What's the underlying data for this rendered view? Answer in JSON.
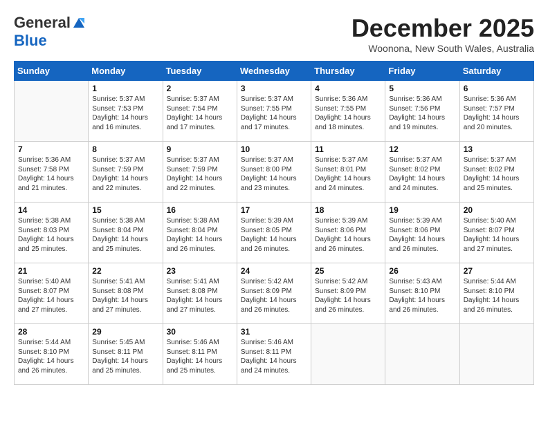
{
  "header": {
    "logo_general": "General",
    "logo_blue": "Blue",
    "month_title": "December 2025",
    "location": "Woonona, New South Wales, Australia"
  },
  "calendar": {
    "days_of_week": [
      "Sunday",
      "Monday",
      "Tuesday",
      "Wednesday",
      "Thursday",
      "Friday",
      "Saturday"
    ],
    "weeks": [
      [
        {
          "day": "",
          "details": ""
        },
        {
          "day": "1",
          "details": "Sunrise: 5:37 AM\nSunset: 7:53 PM\nDaylight: 14 hours\nand 16 minutes."
        },
        {
          "day": "2",
          "details": "Sunrise: 5:37 AM\nSunset: 7:54 PM\nDaylight: 14 hours\nand 17 minutes."
        },
        {
          "day": "3",
          "details": "Sunrise: 5:37 AM\nSunset: 7:55 PM\nDaylight: 14 hours\nand 17 minutes."
        },
        {
          "day": "4",
          "details": "Sunrise: 5:36 AM\nSunset: 7:55 PM\nDaylight: 14 hours\nand 18 minutes."
        },
        {
          "day": "5",
          "details": "Sunrise: 5:36 AM\nSunset: 7:56 PM\nDaylight: 14 hours\nand 19 minutes."
        },
        {
          "day": "6",
          "details": "Sunrise: 5:36 AM\nSunset: 7:57 PM\nDaylight: 14 hours\nand 20 minutes."
        }
      ],
      [
        {
          "day": "7",
          "details": "Sunrise: 5:36 AM\nSunset: 7:58 PM\nDaylight: 14 hours\nand 21 minutes."
        },
        {
          "day": "8",
          "details": "Sunrise: 5:37 AM\nSunset: 7:59 PM\nDaylight: 14 hours\nand 22 minutes."
        },
        {
          "day": "9",
          "details": "Sunrise: 5:37 AM\nSunset: 7:59 PM\nDaylight: 14 hours\nand 22 minutes."
        },
        {
          "day": "10",
          "details": "Sunrise: 5:37 AM\nSunset: 8:00 PM\nDaylight: 14 hours\nand 23 minutes."
        },
        {
          "day": "11",
          "details": "Sunrise: 5:37 AM\nSunset: 8:01 PM\nDaylight: 14 hours\nand 24 minutes."
        },
        {
          "day": "12",
          "details": "Sunrise: 5:37 AM\nSunset: 8:02 PM\nDaylight: 14 hours\nand 24 minutes."
        },
        {
          "day": "13",
          "details": "Sunrise: 5:37 AM\nSunset: 8:02 PM\nDaylight: 14 hours\nand 25 minutes."
        }
      ],
      [
        {
          "day": "14",
          "details": "Sunrise: 5:38 AM\nSunset: 8:03 PM\nDaylight: 14 hours\nand 25 minutes."
        },
        {
          "day": "15",
          "details": "Sunrise: 5:38 AM\nSunset: 8:04 PM\nDaylight: 14 hours\nand 25 minutes."
        },
        {
          "day": "16",
          "details": "Sunrise: 5:38 AM\nSunset: 8:04 PM\nDaylight: 14 hours\nand 26 minutes."
        },
        {
          "day": "17",
          "details": "Sunrise: 5:39 AM\nSunset: 8:05 PM\nDaylight: 14 hours\nand 26 minutes."
        },
        {
          "day": "18",
          "details": "Sunrise: 5:39 AM\nSunset: 8:06 PM\nDaylight: 14 hours\nand 26 minutes."
        },
        {
          "day": "19",
          "details": "Sunrise: 5:39 AM\nSunset: 8:06 PM\nDaylight: 14 hours\nand 26 minutes."
        },
        {
          "day": "20",
          "details": "Sunrise: 5:40 AM\nSunset: 8:07 PM\nDaylight: 14 hours\nand 27 minutes."
        }
      ],
      [
        {
          "day": "21",
          "details": "Sunrise: 5:40 AM\nSunset: 8:07 PM\nDaylight: 14 hours\nand 27 minutes."
        },
        {
          "day": "22",
          "details": "Sunrise: 5:41 AM\nSunset: 8:08 PM\nDaylight: 14 hours\nand 27 minutes."
        },
        {
          "day": "23",
          "details": "Sunrise: 5:41 AM\nSunset: 8:08 PM\nDaylight: 14 hours\nand 27 minutes."
        },
        {
          "day": "24",
          "details": "Sunrise: 5:42 AM\nSunset: 8:09 PM\nDaylight: 14 hours\nand 26 minutes."
        },
        {
          "day": "25",
          "details": "Sunrise: 5:42 AM\nSunset: 8:09 PM\nDaylight: 14 hours\nand 26 minutes."
        },
        {
          "day": "26",
          "details": "Sunrise: 5:43 AM\nSunset: 8:10 PM\nDaylight: 14 hours\nand 26 minutes."
        },
        {
          "day": "27",
          "details": "Sunrise: 5:44 AM\nSunset: 8:10 PM\nDaylight: 14 hours\nand 26 minutes."
        }
      ],
      [
        {
          "day": "28",
          "details": "Sunrise: 5:44 AM\nSunset: 8:10 PM\nDaylight: 14 hours\nand 26 minutes."
        },
        {
          "day": "29",
          "details": "Sunrise: 5:45 AM\nSunset: 8:11 PM\nDaylight: 14 hours\nand 25 minutes."
        },
        {
          "day": "30",
          "details": "Sunrise: 5:46 AM\nSunset: 8:11 PM\nDaylight: 14 hours\nand 25 minutes."
        },
        {
          "day": "31",
          "details": "Sunrise: 5:46 AM\nSunset: 8:11 PM\nDaylight: 14 hours\nand 24 minutes."
        },
        {
          "day": "",
          "details": ""
        },
        {
          "day": "",
          "details": ""
        },
        {
          "day": "",
          "details": ""
        }
      ]
    ]
  }
}
